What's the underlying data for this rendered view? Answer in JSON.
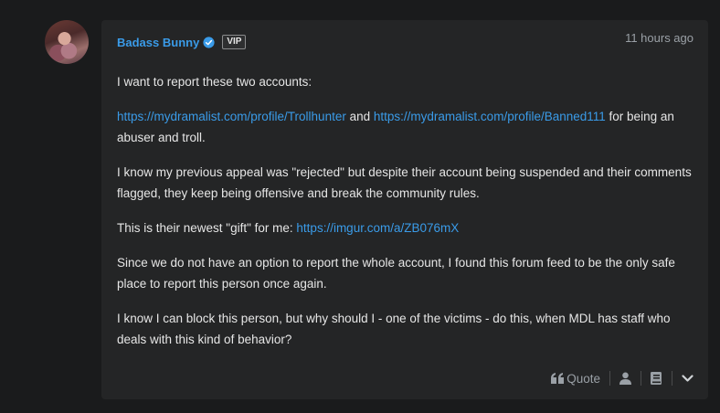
{
  "post": {
    "author": "Badass Bunny",
    "badge": "VIP",
    "time": "11 hours ago",
    "p1": "I want to report these two accounts:",
    "p2": {
      "link1": "https://mydramalist.com/profile/Trollhunter",
      "and": "and",
      "link2": "https://mydramalist.com/profile/Banned111",
      "rest": "for being an abuser and troll."
    },
    "p3": "I know my previous appeal was \"rejected\" but despite their account being suspended and their comments flagged, they keep being offensive and break the community rules.",
    "p4": {
      "text": "This is their newest \"gift\" for me:",
      "link": "https://imgur.com/a/ZB076mX"
    },
    "p5": "Since we do not have an option to report the whole account, I found this forum feed to be the only safe place to report this person once again.",
    "p6": "I know I can block this person, but why should I - one of the victims - do this, when MDL has staff who deals with this kind of behavior?"
  },
  "footer": {
    "quote_label": "Quote"
  },
  "icons": [
    "verified-icon",
    "quote-icon",
    "user-icon",
    "book-icon",
    "chevron-down-icon"
  ],
  "colors": {
    "link": "#3a9be8",
    "card": "#242526",
    "background": "#1a1b1c"
  }
}
